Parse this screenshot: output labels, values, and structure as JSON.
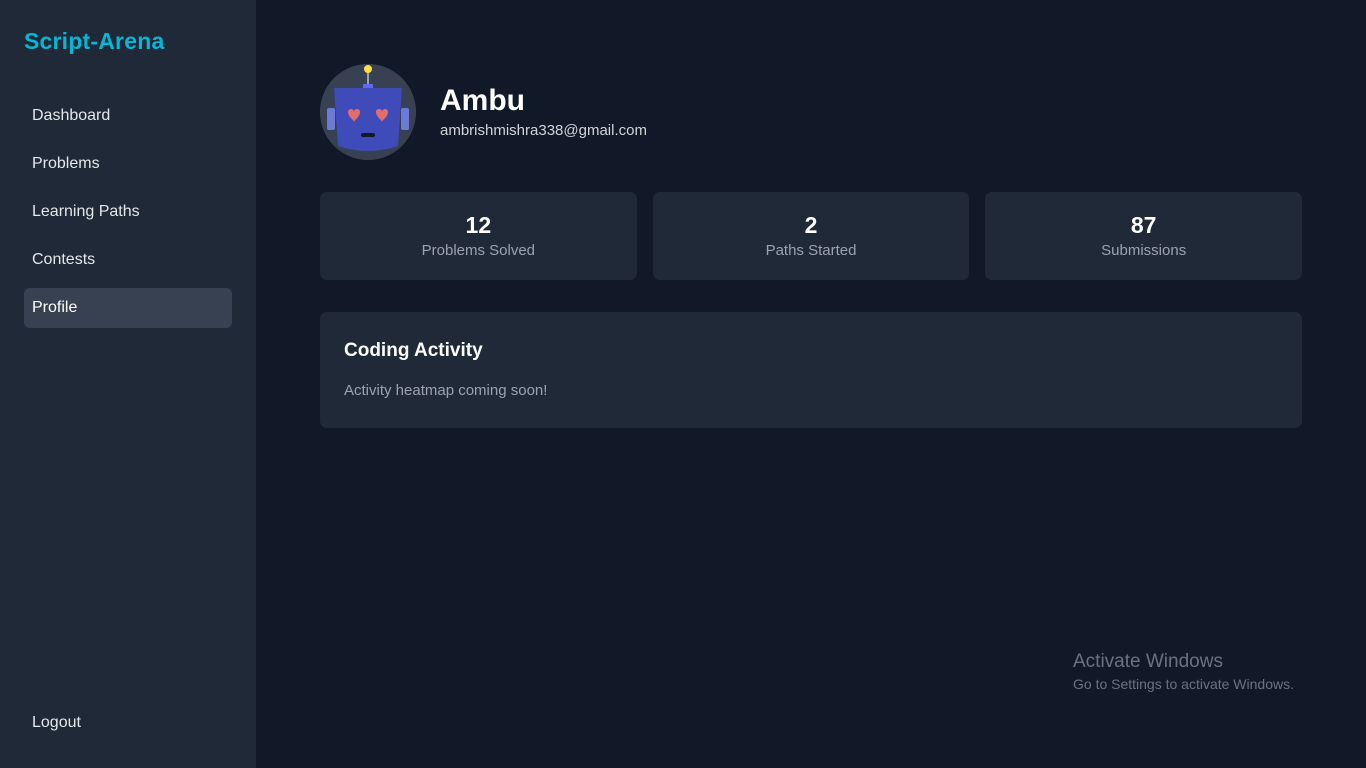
{
  "sidebar": {
    "brand": "Script-Arena",
    "items": [
      {
        "label": "Dashboard"
      },
      {
        "label": "Problems"
      },
      {
        "label": "Learning Paths"
      },
      {
        "label": "Contests"
      },
      {
        "label": "Profile"
      }
    ],
    "active_item": "Profile",
    "logout_label": "Logout"
  },
  "profile": {
    "avatar_icon": "robot-avatar-icon",
    "name": "Ambu",
    "email": "ambrishmishra338@gmail.com"
  },
  "stats": [
    {
      "value": "12",
      "label": "Problems Solved"
    },
    {
      "value": "2",
      "label": "Paths Started"
    },
    {
      "value": "87",
      "label": "Submissions"
    }
  ],
  "activity": {
    "title": "Coding Activity",
    "message": "Activity heatmap coming soon!"
  },
  "watermark": {
    "title": "Activate Windows",
    "subtitle": "Go to Settings to activate Windows."
  },
  "colors": {
    "brand": "#06b6d4",
    "background": "#111827",
    "panel": "#1f2937",
    "active_nav": "#374151"
  }
}
